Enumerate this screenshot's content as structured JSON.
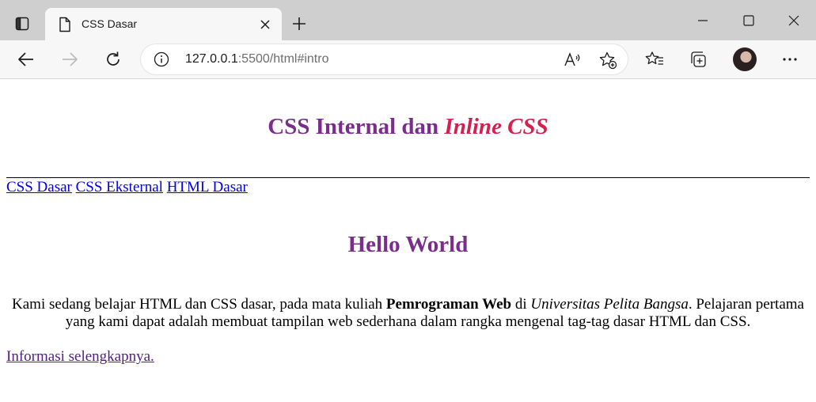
{
  "browser": {
    "tab_title": "CSS Dasar",
    "url_host": "127.0.0.1",
    "url_rest": ":5500/html#intro"
  },
  "page": {
    "heading_main": "CSS Internal dan ",
    "heading_inline": "Inline CSS",
    "nav_links": [
      "CSS Dasar",
      "CSS Eksternal",
      "HTML Dasar"
    ],
    "hello": "Hello World",
    "para_1": "Kami sedang belajar HTML dan CSS dasar, pada mata kuliah ",
    "para_bold": "Pemrograman Web",
    "para_2": " di ",
    "para_italic": "Universitas Pelita Bangsa",
    "para_3": ". Pelajaran pertama yang kami dapat adalah membuat tampilan web sederhana dalam rangka mengenal tag-tag dasar HTML dan CSS.",
    "more_link": "Informasi selengkapnya."
  },
  "colors": {
    "heading": "#7a2d8a",
    "inline": "#d41f4f",
    "link": "#0000ee",
    "visited": "#551a8b"
  },
  "icons": [
    "tab-actions-icon",
    "file-icon",
    "close-icon",
    "plus-icon",
    "minimize-icon",
    "maximize-icon",
    "window-close-icon",
    "back-icon",
    "forward-icon",
    "refresh-icon",
    "info-icon",
    "read-aloud-icon",
    "add-favorite-icon",
    "favorites-icon",
    "collections-icon",
    "more-icon"
  ]
}
